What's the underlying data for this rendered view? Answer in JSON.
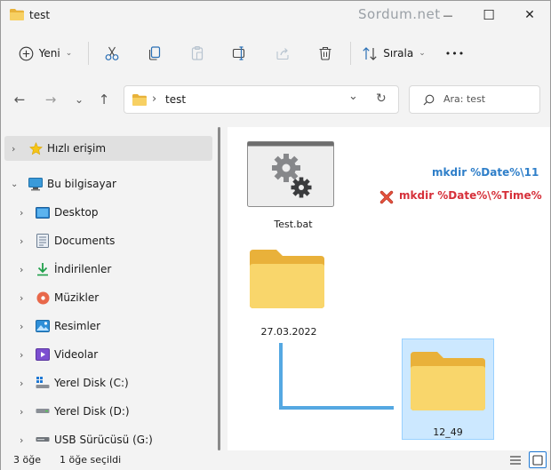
{
  "window": {
    "title": "test",
    "watermark": "Sordum.net",
    "controls": {
      "minimize": "—",
      "maximize": "☐",
      "close": "✕"
    }
  },
  "toolbar": {
    "new_label": "Yeni",
    "sort_label": "Sırala",
    "more_label": "•••",
    "icons": [
      "plus-circle-icon",
      "scissors-icon",
      "copy-icon",
      "paste-icon",
      "rename-icon",
      "share-icon",
      "trash-icon",
      "sort-icon"
    ]
  },
  "address": {
    "path": "test",
    "separator": "›",
    "dropdown": "⌄",
    "refresh": "↻"
  },
  "search": {
    "placeholder": "Ara: test"
  },
  "nav": {
    "back": "←",
    "forward": "→",
    "recent": "⌄",
    "up": "↑"
  },
  "sidebar": {
    "items": [
      {
        "label": "Hızlı erişim",
        "icon": "star-icon",
        "expanded": false,
        "selected": true
      },
      {
        "label": "Bu bilgisayar",
        "icon": "computer-icon",
        "expanded": true,
        "selected": false
      },
      {
        "label": "Desktop",
        "icon": "desktop-icon"
      },
      {
        "label": "Documents",
        "icon": "documents-icon"
      },
      {
        "label": "İndirilenler",
        "icon": "download-icon"
      },
      {
        "label": "Müzikler",
        "icon": "music-icon"
      },
      {
        "label": "Resimler",
        "icon": "pictures-icon"
      },
      {
        "label": "Videolar",
        "icon": "videos-icon"
      },
      {
        "label": "Yerel Disk (C:)",
        "icon": "windows-drive-icon"
      },
      {
        "label": "Yerel Disk (D:)",
        "icon": "drive-icon"
      },
      {
        "label": "USB Sürücüsü (G:)",
        "icon": "usb-drive-icon"
      }
    ]
  },
  "files": [
    {
      "name": "Test.bat",
      "type": "batch-file"
    },
    {
      "name": "27.03.2022",
      "type": "folder"
    },
    {
      "name": "12_49",
      "type": "folder",
      "selected": true
    }
  ],
  "annotations": {
    "ok": "mkdir %Date%\\11",
    "wrong": "mkdir %Date%\\%Time%"
  },
  "status": {
    "count": "3 öğe",
    "selection": "1 öğe seçildi"
  },
  "colors": {
    "accent": "#1e78d4",
    "annotation_blue": "#2f7fc9",
    "annotation_red": "#d6303a",
    "connector": "#55a8e2",
    "selection_bg": "#cce8ff",
    "folder": "#f7c948"
  }
}
